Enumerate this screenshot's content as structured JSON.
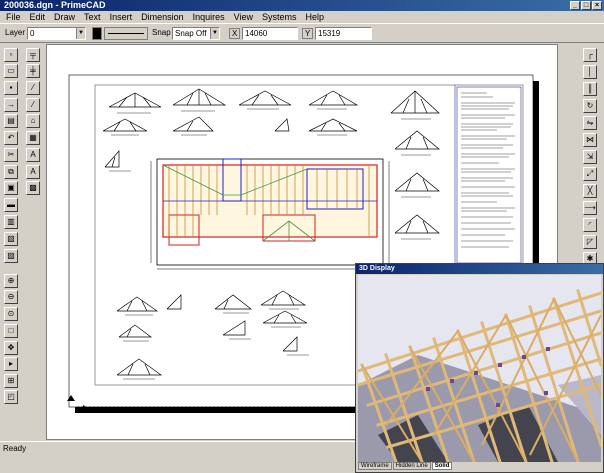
{
  "window": {
    "title": "200036.dgn - PrimeCAD"
  },
  "menu": [
    "File",
    "Edit",
    "Draw",
    "Text",
    "Insert",
    "Dimension",
    "Inquires",
    "View",
    "Systems",
    "Help"
  ],
  "toolbar": {
    "layer_label": "Layer",
    "layer_value": "0",
    "snap_label": "Snap",
    "snap_value": "Snap Off",
    "x_label": "X",
    "x_value": "14060",
    "y_label": "Y",
    "y_value": "15319"
  },
  "status": {
    "text": "Ready"
  },
  "viewer": {
    "title": "3D Display",
    "tabs": [
      "Wireframe",
      "Hidden Line",
      "Solid"
    ],
    "active_tab": "Solid"
  },
  "colors": {
    "titlebar": "#0a246a",
    "timber": "#e0b978",
    "frame_plan_red": "#d42020",
    "frame_plan_blue": "#2020c8"
  }
}
